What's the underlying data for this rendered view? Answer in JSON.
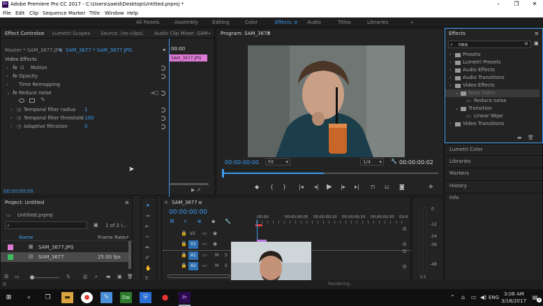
{
  "window": {
    "title": "Adobe Premiere Pro CC 2017 - C:\\Users\\saeid\\Desktop\\Untitled.prproj *",
    "logo": "Pr",
    "min": "–",
    "max": "❐",
    "close": "✕"
  },
  "menu": [
    "File",
    "Edit",
    "Clip",
    "Sequence",
    "Marker",
    "Title",
    "Window",
    "Help"
  ],
  "workspaces": [
    "All Panels",
    "Assembly",
    "Editing",
    "Color",
    "Effects",
    "Audio",
    "Titles",
    "Libraries"
  ],
  "ws_more": "»",
  "effect_controls": {
    "tabs": [
      "Effect Controls",
      "Lumetri Scopes",
      "Source: (no clips)",
      "Audio Clip Mixer: SAM"
    ],
    "more": "»",
    "master": "Master * SAM_3677.JPG",
    "clip": "SAM_3677 * SAM_3677.JPG",
    "timecode_head": "00:00",
    "clip_label": "SAM_3677.JPG",
    "section": "Video Effects",
    "rows": [
      {
        "label": "Motion",
        "fx": "fx"
      },
      {
        "label": "Opacity",
        "fx": "fx"
      },
      {
        "label": "Time Remapping",
        "fx": ""
      },
      {
        "label": "Reduce noise",
        "fx": "fx"
      }
    ],
    "params": [
      {
        "label": "Temporal filter radius",
        "value": "1"
      },
      {
        "label": "Temporal filter threshold",
        "value": "100"
      },
      {
        "label": "Adaptive filtration",
        "value": "0"
      }
    ],
    "timecode": "00:00:00:00"
  },
  "program": {
    "title": "Program: SAM_3677",
    "timecode": "00:00:00:00",
    "fit": "Fit",
    "ratio": "1/4",
    "duration": "00:00:00:02",
    "playhead_pct": 47
  },
  "effects_panel": {
    "title": "Effects",
    "search": "nea",
    "tree": [
      {
        "label": "Presets",
        "indent": 0,
        "type": "folder"
      },
      {
        "label": "Lumetri Presets",
        "indent": 0,
        "type": "folder"
      },
      {
        "label": "Audio Effects",
        "indent": 0,
        "type": "folder"
      },
      {
        "label": "Audio Transitions",
        "indent": 0,
        "type": "folder"
      },
      {
        "label": "Video Effects",
        "indent": 0,
        "type": "folder"
      },
      {
        "label": "Neat Video",
        "indent": 1,
        "type": "folder",
        "selected": true
      },
      {
        "label": "Reduce noise",
        "indent": 2,
        "type": "effect"
      },
      {
        "label": "Transition",
        "indent": 1,
        "type": "folder"
      },
      {
        "label": "Linear Wipe",
        "indent": 2,
        "type": "effect"
      },
      {
        "label": "Video Transitions",
        "indent": 0,
        "type": "folder"
      }
    ],
    "sections": [
      "Lumetri Color",
      "Libraries",
      "Markers",
      "History",
      "Info"
    ]
  },
  "project": {
    "title": "Project: Untitled",
    "file": "Untitled.prproj",
    "count": "1 of 2 i...",
    "columns": [
      "Name",
      "Frame Rate"
    ],
    "items": [
      {
        "name": "SAM_3677.JPG",
        "rate": "",
        "color": "#e07ad7"
      },
      {
        "name": "SAM_3677",
        "rate": "25.00 fps",
        "color": "#3dbb5e"
      }
    ]
  },
  "timeline": {
    "title": "SAM_3677",
    "timecode": "00:00:00:00",
    "ruler": [
      ":00:00",
      "00:00:00:05",
      "00:00:00:10",
      "00:00:00:15",
      "00:00:00:20",
      "00:0"
    ],
    "tracks": [
      {
        "name": "V2",
        "kind": "video"
      },
      {
        "name": "V1",
        "kind": "video"
      },
      {
        "name": "A1",
        "kind": "audio",
        "m": "M",
        "s": "S"
      },
      {
        "name": "A2",
        "kind": "audio",
        "m": "M",
        "s": "S"
      }
    ]
  },
  "audio_meter": {
    "labels": [
      "0",
      "-12",
      "-24",
      "-36",
      "-48"
    ],
    "bottom": "S S"
  },
  "taskbar": {
    "time": "3:08 AM",
    "date": "3/18/2017",
    "lang": "ENG",
    "notif": "1",
    "status": "Rendering..."
  },
  "colors": {
    "accent": "#3b9cf2",
    "clip_pink": "#e07ad7",
    "v1_blue": "#2d6fb3"
  }
}
